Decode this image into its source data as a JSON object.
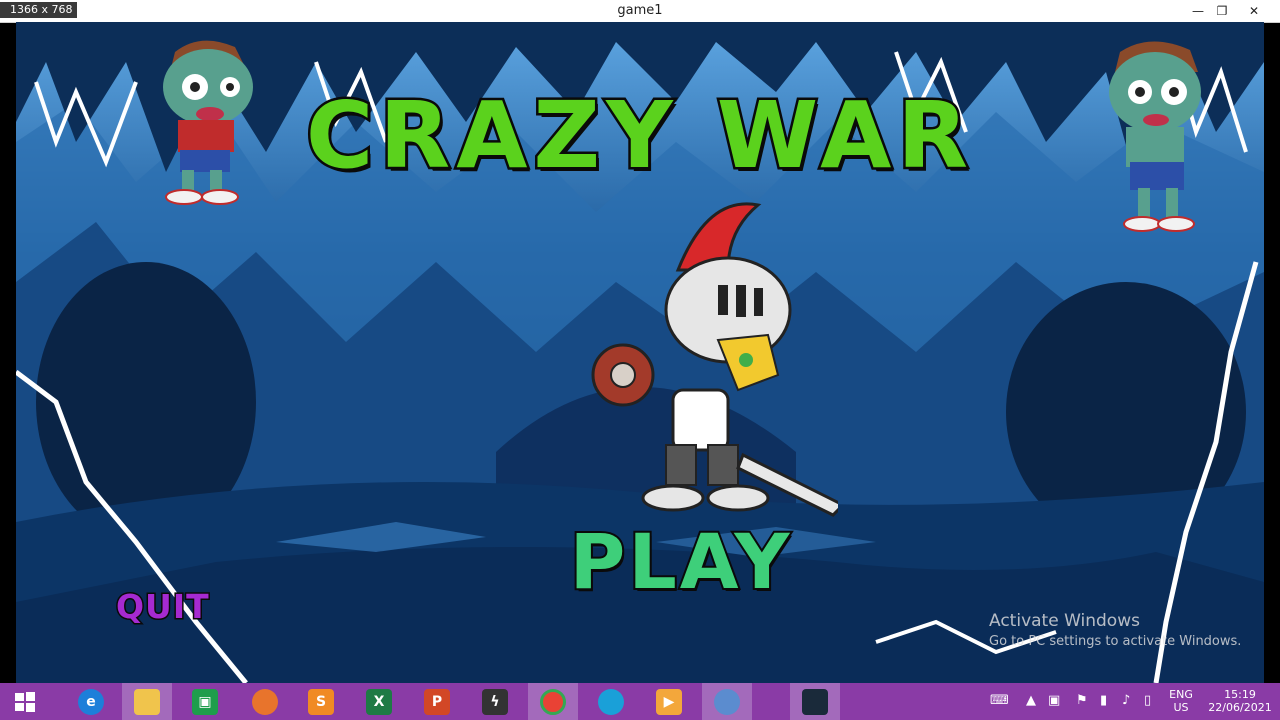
{
  "window": {
    "size_badge": "1366 x 768",
    "title": "game1",
    "minimize": "—",
    "restore": "❐",
    "close": "✕"
  },
  "game": {
    "title": "CRAZY WAR",
    "play_label": "PLAY",
    "quit_label": "QUIT",
    "colors": {
      "title_fill": "#5bd21d",
      "play_fill": "#3ecf7a",
      "quit_fill": "#a52ad1",
      "cave_dark": "#0a2a52",
      "cave_light": "#4a8fd4"
    }
  },
  "watermark": {
    "title": "Activate Windows",
    "subtitle": "Go to PC settings to activate Windows."
  },
  "taskbar": {
    "apps": [
      {
        "name": "start",
        "icon": "windows-icon"
      },
      {
        "name": "internet-explorer",
        "icon": "ie-icon"
      },
      {
        "name": "file-explorer",
        "icon": "folder-icon"
      },
      {
        "name": "store",
        "icon": "store-icon"
      },
      {
        "name": "firefox",
        "icon": "firefox-icon"
      },
      {
        "name": "sublime",
        "icon": "sublime-icon"
      },
      {
        "name": "excel",
        "icon": "excel-icon"
      },
      {
        "name": "powerpoint",
        "icon": "powerpoint-icon"
      },
      {
        "name": "app-dark",
        "icon": "bolt-icon"
      },
      {
        "name": "chrome",
        "icon": "chrome-icon"
      },
      {
        "name": "edge",
        "icon": "edge-icon"
      },
      {
        "name": "media",
        "icon": "media-icon"
      },
      {
        "name": "game-app",
        "icon": "game-icon"
      },
      {
        "name": "game1-window",
        "icon": "game-thumb-icon"
      }
    ],
    "tray": {
      "language_top": "ENG",
      "language_bottom": "US",
      "time": "15:19",
      "date": "22/06/2021"
    }
  }
}
